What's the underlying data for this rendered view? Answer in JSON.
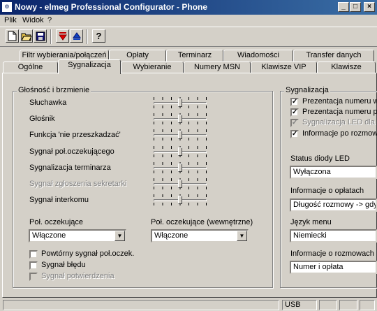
{
  "window": {
    "title": "Nowy - elmeg Professional Configurator - Phone",
    "controls": [
      "_",
      "□",
      "×"
    ]
  },
  "menu": [
    "Plik",
    "Widok",
    "?"
  ],
  "toolbar": {
    "icons": [
      "new-document-icon",
      "open-folder-icon",
      "save-disk-icon",
      "download-arrow-icon",
      "upload-arrow-icon",
      "help-icon"
    ],
    "help_label": "?"
  },
  "tabs": {
    "row1": [
      "Filtr wybierania/połączeń",
      "Opłaty",
      "Terminarz",
      "Wiadomości",
      "Transfer danych"
    ],
    "row2": [
      "Ogólne",
      "Sygnalizacja",
      "Wybieranie",
      "Numery MSN",
      "Klawisze VIP",
      "Klawisze"
    ],
    "active": "Sygnalizacja"
  },
  "volume_group": {
    "title": "Głośność i brzmienie",
    "sliders": [
      {
        "label": "Słuchawka",
        "value": 3,
        "enabled": true
      },
      {
        "label": "Głośnik",
        "value": 3,
        "enabled": true
      },
      {
        "label": "Funkcja 'nie przeszkadzać'",
        "value": 3,
        "enabled": true
      },
      {
        "label": "Sygnał poł.oczekującego",
        "value": 3,
        "enabled": true
      },
      {
        "label": "Sygnalizacja terminarza",
        "value": 3,
        "enabled": true
      },
      {
        "label": "Sygnał zgłoszenia sekretarki",
        "value": 3,
        "enabled": false
      },
      {
        "label": "Sygnał interkomu",
        "value": 3,
        "enabled": true
      }
    ],
    "slider_max": 6,
    "waiting_call": {
      "label": "Poł. oczekujące",
      "value": "Włączone"
    },
    "waiting_call_internal": {
      "label": "Poł. oczekujące (wewnętrzne)",
      "value": "Włączone"
    },
    "checkboxes": [
      {
        "label": "Powtórny sygnał poł.oczek.",
        "checked": false,
        "enabled": true
      },
      {
        "label": "Sygnał błędu",
        "checked": false,
        "enabled": true
      },
      {
        "label": "Sygnał potwierdzenia",
        "checked": false,
        "enabled": false
      }
    ]
  },
  "signaling_group": {
    "title": "Sygnalizacja",
    "checkboxes": [
      {
        "label": "Prezentacja numeru wy",
        "checked": true,
        "enabled": true
      },
      {
        "label": "Prezentacja numeru pr",
        "checked": true,
        "enabled": true
      },
      {
        "label": "Sygnalizacja LED dla li",
        "checked": true,
        "enabled": false
      },
      {
        "label": "Informacje po rozmowie",
        "checked": true,
        "enabled": true
      }
    ],
    "led_status": {
      "label": "Status diody LED",
      "value": "Wyłączona"
    },
    "charges_info": {
      "label": "Informacje o opłatach",
      "value": "Długość rozmowy -> gdy l"
    },
    "menu_language": {
      "label": "Język menu",
      "value": "Niemiecki"
    },
    "call_info": {
      "label": "Informacje o rozmowach",
      "value": "Numer i opłata"
    }
  },
  "status": {
    "connection": "USB"
  }
}
